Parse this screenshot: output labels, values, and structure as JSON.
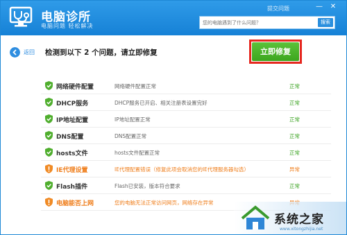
{
  "header": {
    "title": "电脑诊所",
    "subtitle": "电脑问题  轻松解决",
    "feedback": "提交问题",
    "min_glyph": "—",
    "close_glyph": "✕"
  },
  "search": {
    "placeholder": "您的电脑遇到了什么问题？",
    "button": "搜索"
  },
  "topbar": {
    "back": "返回",
    "headline": "检测到以下 2 个问题，请立即修复",
    "fix_button": "立即修复"
  },
  "items": [
    {
      "name": "网络硬件配置",
      "desc": "网络硬件配置正常",
      "status": "正常",
      "state": "ok"
    },
    {
      "name": "DHCP服务",
      "desc": "DHCP服务已开启、相关注册表设置完好",
      "status": "正常",
      "state": "ok"
    },
    {
      "name": "IP地址配置",
      "desc": "IP地址配置正常",
      "status": "正常",
      "state": "ok"
    },
    {
      "name": "DNS配置",
      "desc": "DNS配置正常",
      "status": "正常",
      "state": "ok"
    },
    {
      "name": "hosts文件",
      "desc": "hosts文件配置正常",
      "status": "正常",
      "state": "ok"
    },
    {
      "name": "IE代理设置",
      "desc": "IE代理配置错误（修复此项会取消您的IE代理服务器勾选）",
      "status": "异常",
      "state": "err"
    },
    {
      "name": "Flash插件",
      "desc": "Flash已安装，版本符合要求",
      "status": "正常",
      "state": "ok"
    },
    {
      "name": "电脑能否上网",
      "desc": "您的电脑无法正常访问网页，网络存在异常",
      "status": "异常",
      "state": "err"
    }
  ],
  "colors": {
    "header": "#1e88d6",
    "ok": "#3aa320",
    "error": "#ef7d1a",
    "fix_button": "#4cb52c",
    "highlight": "#e6271f"
  },
  "watermark": {
    "text": "系统之家",
    "url": "www.xitongzhijia.net"
  }
}
